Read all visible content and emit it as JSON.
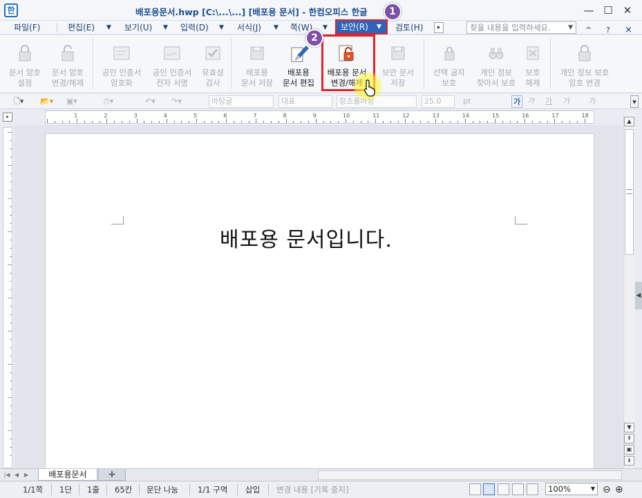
{
  "window": {
    "title": "배포용문서.hwp [C:\\...\\...] [배포용 문서] - 한컴오피스 한글",
    "app_icon": "hangul-icon",
    "controls": [
      "minimize",
      "maximize",
      "close"
    ]
  },
  "menubar": {
    "items": [
      {
        "label": "파일(F)"
      },
      {
        "label": "편집(E)"
      },
      {
        "label": "보기(U)"
      },
      {
        "label": "입력(D)"
      },
      {
        "label": "서식(J)"
      },
      {
        "label": "쪽(W)"
      },
      {
        "label": "보안(R)",
        "active": true
      },
      {
        "label": "검토(H)"
      }
    ],
    "search_placeholder": "찾을 내용을 입력하세요.",
    "right_controls": [
      "^",
      "?",
      "×"
    ]
  },
  "ribbon": {
    "buttons": [
      {
        "label": "문서 암호\n설정",
        "enabled": false
      },
      {
        "label": "문서 암호\n변경/해제",
        "enabled": false
      },
      {
        "label": "공인 인증서\n암호화",
        "enabled": false
      },
      {
        "label": "공인 인증서\n전자 서명",
        "enabled": false
      },
      {
        "label": "유효성\n검사",
        "enabled": false
      },
      {
        "label": "배포용\n문서 저장",
        "enabled": false
      },
      {
        "label": "배포용\n문서 편집",
        "enabled": true
      },
      {
        "label": "배포용 문서\n변경/해제",
        "enabled": true,
        "highlighted": true
      },
      {
        "label": "보안 문서\n저장",
        "enabled": false
      },
      {
        "label": "선택 글자\n보호",
        "enabled": false
      },
      {
        "label": "개인 정보\n찾아서 보호",
        "enabled": false
      },
      {
        "label": "보호\n해제",
        "enabled": false
      },
      {
        "label": "개인 정보 보호\n암호 변경",
        "enabled": false
      }
    ]
  },
  "format_toolbar": {
    "style": "바탕글",
    "lang": "대표",
    "font": "함초롬바탕",
    "size": "25.0",
    "unit": "pt",
    "text_styles": [
      "가",
      "가",
      "가",
      "가",
      "가"
    ]
  },
  "ruler": {
    "ticks": [
      "1",
      "2",
      "3",
      "4",
      "5",
      "6",
      "7",
      "8",
      "9",
      "10",
      "11",
      "12",
      "13",
      "14",
      "15",
      "16",
      "17",
      "18"
    ]
  },
  "document": {
    "body_text": "배포용 문서입니다."
  },
  "tabs": {
    "doc_tab": "배포용문서",
    "add_tab": "+"
  },
  "statusbar": {
    "page": "1/1쪽",
    "column": "1단",
    "line": "1줄",
    "char": "65칸",
    "paragraph": "문단 나눔",
    "section": "1/1 구역",
    "mode": "삽입",
    "track": "변경 내용 [기록 중지]",
    "zoom": "100%"
  },
  "annotations": {
    "step1": "1",
    "step2": "2"
  },
  "colors": {
    "accent": "#2f63b8",
    "highlight": "#e2222c",
    "badge": "#7d4fa7"
  }
}
